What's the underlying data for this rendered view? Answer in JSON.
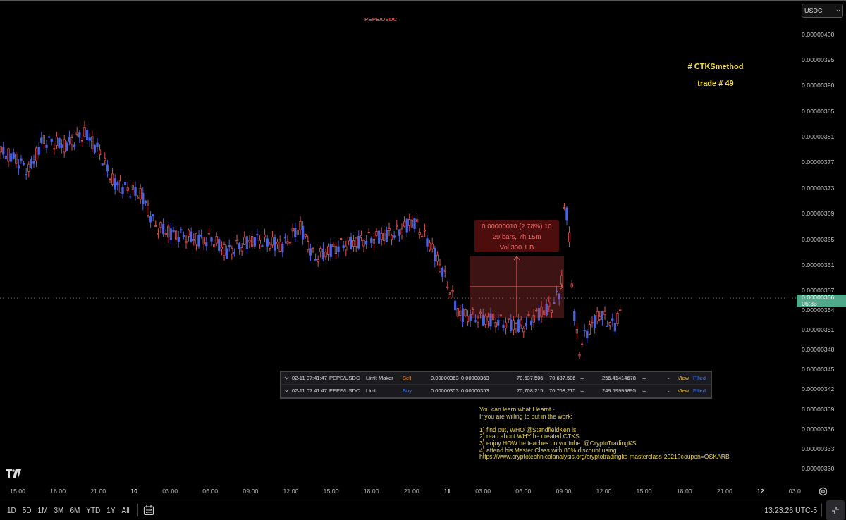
{
  "chart": {
    "symbol": "PEPE/USDC",
    "annotation": [
      "# CTKSmethod",
      "trade # 49"
    ],
    "measure": {
      "lines": [
        "0.00000010 (2.78%) 10",
        "29 bars, 7h 15m",
        "Vol 300.1 B"
      ]
    },
    "orders": [
      {
        "time": "02-11 07:41:47",
        "pair": "PEPE/USDC",
        "type": "Limit Maker",
        "side": "Sell",
        "kind": "sell",
        "price": "0.00000363",
        "avg_price": "0.00000363",
        "amount": "70,637,506",
        "filled": "70,637,506",
        "column_9": "--",
        "total": "256.41414678",
        "column_11": "--",
        "column_12": "-",
        "action": "View",
        "status": "Filled"
      },
      {
        "time": "02-11 07:41:47",
        "pair": "PEPE/USDC",
        "type": "Limit",
        "side": "Buy",
        "kind": "buy",
        "price": "0.00000353",
        "avg_price": "0.00000353",
        "amount": "70,708,215",
        "filled": "70,708,215",
        "column_9": "--",
        "total": "249.59999895",
        "column_11": "--",
        "column_12": "-",
        "action": "View",
        "status": "Filled"
      }
    ],
    "note": {
      "intro": [
        "You can learn what I learnt -",
        "If you are willing to put in the work:"
      ],
      "steps": [
        "1) find out, WHO @StandfieldKen is",
        "2) read about WHY he created CTKS",
        "3) enjoy HOW he teaches on youtube: @CryptoTradingKS",
        "4) attend his Master Class with 80% discount using",
        "https://www.cryptotechnicalanalysis.org/cryptotradingks-masterclass-2021?coupon=OSKARB"
      ]
    }
  },
  "price_axis": {
    "currency": "USDC",
    "ticks": [
      "0.00000400",
      "0.00000395",
      "0.00000390",
      "0.00000385",
      "0.00000381",
      "0.00000377",
      "0.00000373",
      "0.00000369",
      "0.00000365",
      "0.00000361",
      "0.00000357",
      "0.00000354",
      "0.00000351",
      "0.00000348",
      "0.00000345",
      "0.00000342",
      "0.00000339",
      "0.00000336",
      "0.00000333",
      "0.00000330"
    ],
    "last_price": "0.00000356",
    "countdown": "06:33"
  },
  "time_axis": [
    {
      "label": "15:00",
      "kind": "time"
    },
    {
      "label": "18:00",
      "kind": "time"
    },
    {
      "label": "21:00",
      "kind": "time"
    },
    {
      "label": "10",
      "kind": "day"
    },
    {
      "label": "03:00",
      "kind": "time"
    },
    {
      "label": "06:00",
      "kind": "time"
    },
    {
      "label": "09:00",
      "kind": "time"
    },
    {
      "label": "12:00",
      "kind": "time"
    },
    {
      "label": "15:00",
      "kind": "time"
    },
    {
      "label": "18:00",
      "kind": "time"
    },
    {
      "label": "21:00",
      "kind": "time"
    },
    {
      "label": "11",
      "kind": "day"
    },
    {
      "label": "03:00",
      "kind": "time"
    },
    {
      "label": "06:00",
      "kind": "time"
    },
    {
      "label": "09:00",
      "kind": "time"
    },
    {
      "label": "12:00",
      "kind": "time"
    },
    {
      "label": "15:00",
      "kind": "time"
    },
    {
      "label": "18:00",
      "kind": "time"
    },
    {
      "label": "21:00",
      "kind": "time"
    },
    {
      "label": "12",
      "kind": "day"
    },
    {
      "label": "03:0",
      "kind": "time"
    }
  ],
  "ranges": [
    "1D",
    "5D",
    "1M",
    "3M",
    "6M",
    "YTD",
    "1Y",
    "All"
  ],
  "clock": "13:23:26 UTC-5"
}
